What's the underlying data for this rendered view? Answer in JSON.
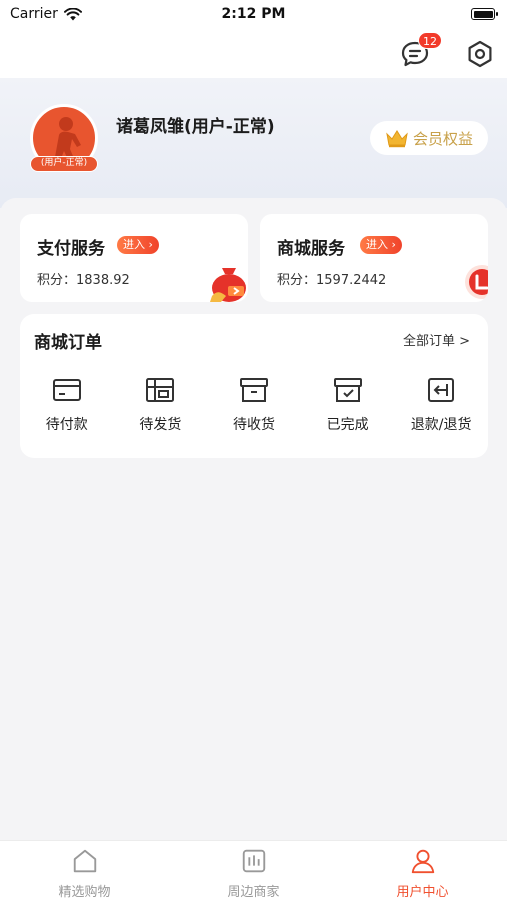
{
  "status_bar": {
    "carrier": "Carrier",
    "time": "2:12 PM"
  },
  "top_actions": {
    "message_badge": "12"
  },
  "profile": {
    "name": "诸葛凤雏(用户-正常)",
    "avatar_tag": "(用户-正常)",
    "vip_label": "会员权益"
  },
  "services": [
    {
      "title": "支付服务",
      "enter_label": "进入",
      "points_label": "积分：",
      "points_value": "1838.92"
    },
    {
      "title": "商城服务",
      "enter_label": "进入",
      "points_label": "积分：",
      "points_value": "1597.2442"
    }
  ],
  "orders": {
    "title": "商城订单",
    "view_all": "全部订单 >",
    "items": [
      {
        "label": "待付款",
        "icon": "card-icon"
      },
      {
        "label": "待发货",
        "icon": "store-icon"
      },
      {
        "label": "待收货",
        "icon": "box-icon"
      },
      {
        "label": "已完成",
        "icon": "box-check-icon"
      },
      {
        "label": "退款/退货",
        "icon": "return-icon"
      }
    ]
  },
  "tab_bar": [
    {
      "label": "精选购物",
      "icon": "home-icon",
      "active": false
    },
    {
      "label": "周边商家",
      "icon": "chart-icon",
      "active": false
    },
    {
      "label": "用户中心",
      "icon": "user-icon",
      "active": true
    }
  ],
  "colors": {
    "accent": "#f0502f",
    "badge": "#f23a2a",
    "gold": "#c8a14a"
  }
}
